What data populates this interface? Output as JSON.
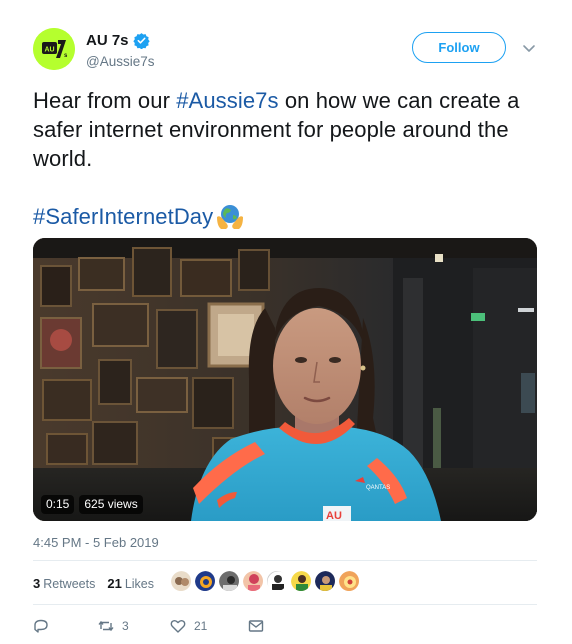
{
  "account": {
    "display_name": "AU 7s",
    "handle": "@Aussie7s",
    "verified": true,
    "avatar_text": "AU7s",
    "avatar_color": "#b5ff2e"
  },
  "actions": {
    "follow_label": "Follow",
    "caret_icon": "chevron-down-icon"
  },
  "tweet": {
    "text_before": "Hear from our ",
    "hashtag1": "#Aussie7s",
    "text_after": " on how we can create a safer internet environment for people around the world.",
    "hashtag2": "#SaferInternetDay",
    "emoji_icon": "globe-in-hands-icon"
  },
  "video": {
    "duration": "0:15",
    "views": "625 views",
    "jersey_sponsor": "QANTAS",
    "jersey_text": "AU"
  },
  "meta": {
    "timestamp": "4:45 PM - 5 Feb 2019"
  },
  "stats": {
    "retweets_count": "3",
    "retweets_label": "Retweets",
    "likes_count": "21",
    "likes_label": "Likes"
  },
  "footer": {
    "reply_icon": "reply-icon",
    "retweet_icon": "retweet-icon",
    "retweet_count": "3",
    "like_icon": "heart-icon",
    "like_count": "21",
    "dm_icon": "envelope-icon"
  },
  "colors": {
    "link": "#1b5aa5",
    "twitter_blue": "#1da1f2",
    "muted": "#657786"
  }
}
